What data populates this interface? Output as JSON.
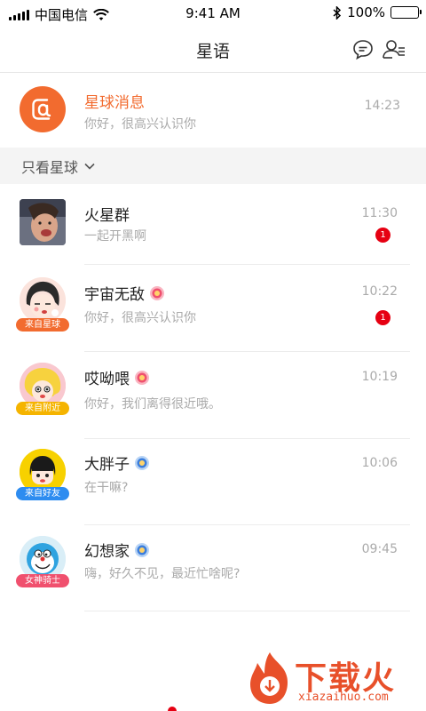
{
  "status_bar": {
    "carrier": "中国电信",
    "time": "9:41 AM",
    "battery": "100%"
  },
  "nav": {
    "title": "星语",
    "icons": [
      "chat-bubble-icon",
      "contacts-icon"
    ]
  },
  "system_message": {
    "title": "星球消息",
    "subtitle": "你好，很高兴认识你",
    "time": "14:23",
    "icon": "at-sign-icon",
    "accent_color": "#f26b2f"
  },
  "filter": {
    "label": "只看星球",
    "icon": "chevron-down-icon"
  },
  "chats": [
    {
      "name": "火星群",
      "message": "一起开黑啊",
      "time": "11:30",
      "badge": "1",
      "tag": "",
      "verified": ""
    },
    {
      "name": "宇宙无敌",
      "message": "你好，很高兴认识你",
      "time": "10:22",
      "badge": "1",
      "tag": "来自星球",
      "tag_color": "#f26b2f",
      "verified": "flower-badge-pink"
    },
    {
      "name": "哎呦喂",
      "message": "你好，我们离得很近哦。",
      "time": "10:19",
      "badge": "",
      "tag": "来自附近",
      "tag_color": "#f5b400",
      "verified": "flower-badge-pink"
    },
    {
      "name": "大胖子",
      "message": "在干嘛?",
      "time": "10:06",
      "badge": "",
      "tag": "来自好友",
      "tag_color": "#2d8cf0",
      "verified": "flower-badge-blue"
    },
    {
      "name": "幻想家",
      "message": "嗨，好久不见，最近忙啥呢?",
      "time": "09:45",
      "badge": "",
      "tag": "女神骑士",
      "tag_color": "#f0506e",
      "verified": "flower-badge-blue"
    }
  ],
  "watermark": {
    "text": "下载火",
    "url": "xiazaihuo.com"
  }
}
